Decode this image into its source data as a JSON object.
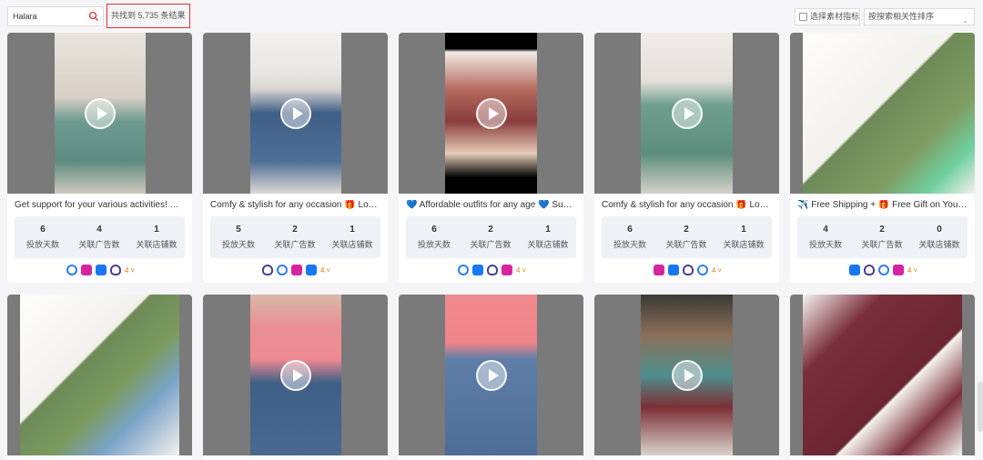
{
  "search": {
    "value": "Halara"
  },
  "result_count": "共找到 5,735 条结果",
  "toolbar": {
    "metric_label": "选择素材指标",
    "sort_label": "按搜索相关性排序"
  },
  "stat_labels": [
    "投放天数",
    "关联广告数",
    "关联店铺数"
  ],
  "cards": [
    {
      "caption": "Get support for your various activities! ✨ ...",
      "stats": [
        "6",
        "4",
        "1"
      ],
      "platforms": [
        "messenger-icon",
        "instagram-icon",
        "facebook-icon",
        "threads-icon"
      ],
      "count": "4"
    },
    {
      "caption": "Comfy & stylish for any occasion 🎁 Look ...",
      "stats": [
        "5",
        "2",
        "1"
      ],
      "platforms": [
        "threads-icon",
        "messenger-icon",
        "instagram-icon",
        "facebook-icon"
      ],
      "count": "4"
    },
    {
      "caption": "💙 Affordable outfits for any age 💙 Supe...",
      "stats": [
        "6",
        "2",
        "1"
      ],
      "platforms": [
        "messenger-icon",
        "facebook-icon",
        "threads-icon",
        "instagram-icon"
      ],
      "count": "4"
    },
    {
      "caption": "Comfy & stylish for any occasion 🎁 Look ...",
      "stats": [
        "6",
        "2",
        "1"
      ],
      "platforms": [
        "instagram-icon",
        "facebook-icon",
        "threads-icon",
        "messenger-icon"
      ],
      "count": "4"
    },
    {
      "caption": "✈️ Free Shipping + 🎁 Free Gift on Your 1...",
      "stats": [
        "4",
        "2",
        "0"
      ],
      "platforms": [
        "facebook-icon",
        "threads-icon",
        "messenger-icon",
        "instagram-icon"
      ],
      "count": "4"
    }
  ],
  "colors": {
    "highlight": "#e0312f",
    "stat_bg": "#eef1f6",
    "count": "#e07a1f"
  }
}
